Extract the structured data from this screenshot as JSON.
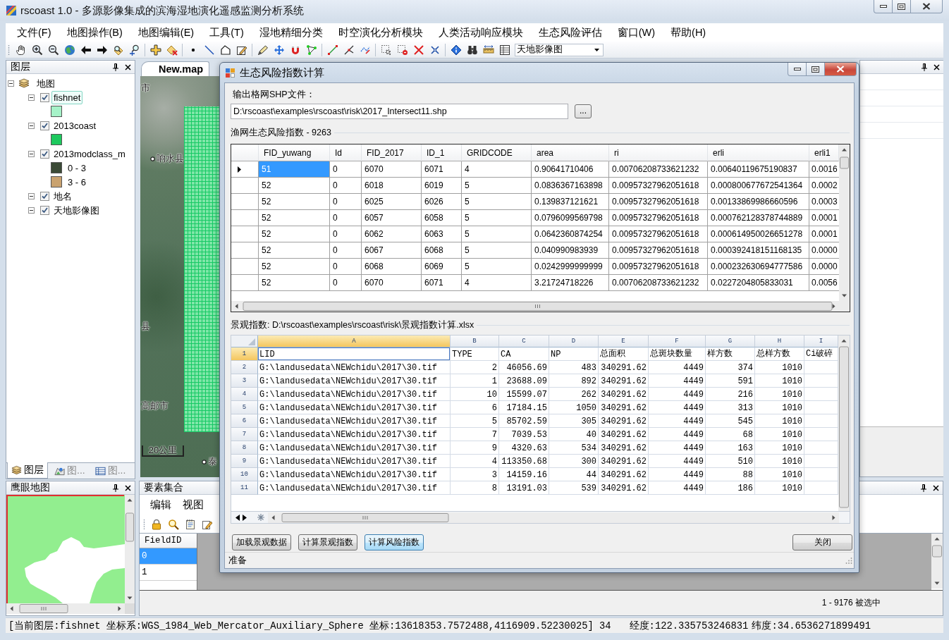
{
  "window": {
    "title": "rscoast 1.0 - 多源影像集成的滨海湿地演化遥感监测分析系统"
  },
  "menu": [
    "文件(F)",
    "地图操作(B)",
    "地图编辑(E)",
    "工具(T)",
    "湿地精细分类",
    "时空演化分析模块",
    "人类活动响应模块",
    "生态风险评估",
    "窗口(W)",
    "帮助(H)"
  ],
  "toolbar": {
    "basemap": "天地影像图"
  },
  "layers_panel": {
    "title": "图层",
    "root": {
      "label": "地图",
      "expanded": true,
      "children": [
        {
          "label": "fishnet",
          "checked": true,
          "expanded": true,
          "selected": true,
          "legend": [
            {
              "color": "#a6f2c8"
            }
          ]
        },
        {
          "label": "2013coast",
          "checked": true,
          "expanded": true,
          "selected": false,
          "legend": [
            {
              "color": "#1ec95e"
            }
          ]
        },
        {
          "label": "2013modclass_m",
          "checked": true,
          "expanded": true,
          "selected": false,
          "legend": [
            {
              "label": "0 - 3",
              "color": "#3b4a36"
            },
            {
              "label": "3 - 6",
              "color": "#c9a26f"
            }
          ]
        },
        {
          "label": "地名",
          "checked": true,
          "expanded": true,
          "selected": false
        },
        {
          "label": "天地影像图",
          "checked": true,
          "expanded": true,
          "selected": false
        }
      ]
    },
    "tabs": [
      {
        "label": "图层",
        "selected": true
      },
      {
        "label": "图...",
        "selected": false
      },
      {
        "label": "图...",
        "selected": false
      }
    ]
  },
  "overview_panel": {
    "title": "鹰眼地图"
  },
  "map_document": {
    "tab": "New.map",
    "place_labels": [
      {
        "text": "市",
        "marker": false
      },
      {
        "text": "响水县",
        "marker": true
      },
      {
        "text": "县",
        "marker": false
      },
      {
        "text": "高邮市",
        "marker": false
      },
      {
        "text": "泰",
        "marker": true
      }
    ],
    "scale_label": "20公里"
  },
  "dialog": {
    "title": "生态风险指数计算",
    "output_label": "输出格网SHP文件：",
    "output_path": "D:\\rscoast\\examples\\rscoast\\risk\\2017_Intersect11.shp",
    "browse_button": "...",
    "grid_label": "渔网生态风险指数 - 9263",
    "grid": {
      "columns": [
        "FID_yuwang",
        "Id",
        "FID_2017",
        "ID_1",
        "GRIDCODE",
        "area",
        "ri",
        "erli",
        "erli1"
      ],
      "rows": [
        {
          "selected": true,
          "cells": [
            "51",
            "0",
            "6070",
            "6071",
            "4",
            "0.90641710406",
            "0.00706208733621232",
            "0.00640119675190837",
            "0.0016"
          ]
        },
        {
          "selected": false,
          "cells": [
            "52",
            "0",
            "6018",
            "6019",
            "5",
            "0.0836367163898",
            "0.00957327962051618",
            "0.000800677672541364",
            "0.0002"
          ]
        },
        {
          "selected": false,
          "cells": [
            "52",
            "0",
            "6025",
            "6026",
            "5",
            "0.139837121621",
            "0.00957327962051618",
            "0.00133869986660596",
            "0.0003"
          ]
        },
        {
          "selected": false,
          "cells": [
            "52",
            "0",
            "6057",
            "6058",
            "5",
            "0.0796099569798",
            "0.00957327962051618",
            "0.000762128378744889",
            "0.0001"
          ]
        },
        {
          "selected": false,
          "cells": [
            "52",
            "0",
            "6062",
            "6063",
            "5",
            "0.0642360874254",
            "0.00957327962051618",
            "0.000614950026651278",
            "0.0001"
          ]
        },
        {
          "selected": false,
          "cells": [
            "52",
            "0",
            "6067",
            "6068",
            "5",
            "0.040990983939",
            "0.00957327962051618",
            "0.000392418151168135",
            "0.0000"
          ]
        },
        {
          "selected": false,
          "cells": [
            "52",
            "0",
            "6068",
            "6069",
            "5",
            "0.0242999999999",
            "0.00957327962051618",
            "0.000232630694777586",
            "0.0000"
          ]
        },
        {
          "selected": false,
          "cells": [
            "52",
            "0",
            "6070",
            "6071",
            "4",
            "3.21724718226",
            "0.00706208733621232",
            "0.0227204805833031",
            "0.0056"
          ]
        }
      ]
    },
    "sheet_label": "景观指数: D:\\rscoast\\examples\\rscoast\\risk\\景观指数计算.xlsx",
    "sheet": {
      "columns": [
        {
          "letter": "A",
          "selected": true
        },
        {
          "letter": "B",
          "selected": false
        },
        {
          "letter": "C",
          "selected": false
        },
        {
          "letter": "D",
          "selected": false
        },
        {
          "letter": "E",
          "selected": false
        },
        {
          "letter": "F",
          "selected": false
        },
        {
          "letter": "G",
          "selected": false
        },
        {
          "letter": "H",
          "selected": false
        },
        {
          "letter": "I",
          "selected": false
        }
      ],
      "rows": [
        {
          "number": "1",
          "selected": true,
          "cells": [
            "LID",
            "TYPE",
            "CA",
            "NP",
            "总面积",
            "总斑块数量",
            "样方数",
            "总样方数",
            "Ci破碎"
          ]
        },
        {
          "number": "2",
          "selected": false,
          "cells": [
            "G:\\landusedata\\NEWchidu\\2017\\30.tif",
            "2",
            "46056.69",
            "483",
            "340291.62",
            "4449",
            "374",
            "1010"
          ]
        },
        {
          "number": "3",
          "selected": false,
          "cells": [
            "G:\\landusedata\\NEWchidu\\2017\\30.tif",
            "1",
            "23688.09",
            "892",
            "340291.62",
            "4449",
            "591",
            "1010"
          ]
        },
        {
          "number": "4",
          "selected": false,
          "cells": [
            "G:\\landusedata\\NEWchidu\\2017\\30.tif",
            "10",
            "15599.07",
            "262",
            "340291.62",
            "4449",
            "216",
            "1010"
          ]
        },
        {
          "number": "5",
          "selected": false,
          "cells": [
            "G:\\landusedata\\NEWchidu\\2017\\30.tif",
            "6",
            "17184.15",
            "1050",
            "340291.62",
            "4449",
            "313",
            "1010"
          ]
        },
        {
          "number": "6",
          "selected": false,
          "cells": [
            "G:\\landusedata\\NEWchidu\\2017\\30.tif",
            "5",
            "85702.59",
            "305",
            "340291.62",
            "4449",
            "545",
            "1010"
          ]
        },
        {
          "number": "7",
          "selected": false,
          "cells": [
            "G:\\landusedata\\NEWchidu\\2017\\30.tif",
            "7",
            "7039.53",
            "40",
            "340291.62",
            "4449",
            "68",
            "1010"
          ]
        },
        {
          "number": "8",
          "selected": false,
          "cells": [
            "G:\\landusedata\\NEWchidu\\2017\\30.tif",
            "9",
            "4320.63",
            "534",
            "340291.62",
            "4449",
            "163",
            "1010"
          ]
        },
        {
          "number": "9",
          "selected": false,
          "cells": [
            "G:\\landusedata\\NEWchidu\\2017\\30.tif",
            "4",
            "113350.68",
            "300",
            "340291.62",
            "4449",
            "510",
            "1010"
          ]
        },
        {
          "number": "10",
          "selected": false,
          "cells": [
            "G:\\landusedata\\NEWchidu\\2017\\30.tif",
            "3",
            "14159.16",
            "44",
            "340291.62",
            "4449",
            "88",
            "1010"
          ]
        },
        {
          "number": "11",
          "selected": false,
          "cells": [
            "G:\\landusedata\\NEWchidu\\2017\\30.tif",
            "8",
            "13191.03",
            "539",
            "340291.62",
            "4449",
            "186",
            "1010"
          ]
        }
      ]
    },
    "buttons": [
      {
        "label": "加载景观数据",
        "focused": false
      },
      {
        "label": "计算景观指数",
        "focused": false
      },
      {
        "label": "计算风险指数",
        "focused": true
      }
    ],
    "close_button": "关闭",
    "status": "准备"
  },
  "feature_panel": {
    "title": "要素集合",
    "menu": [
      "编辑",
      "视图"
    ],
    "table": {
      "column": "FieldID",
      "rows": [
        {
          "value": "0",
          "selected": true
        },
        {
          "value": "1",
          "selected": false
        }
      ]
    },
    "selection_count": "1 - 9176 被选中"
  },
  "status_bar": {
    "layer_info": "[当前图层:fishnet 坐标系:WGS_1984_Web_Mercator_Auxiliary_Sphere 坐标:13618353.7572488,4116909.52230025] 34",
    "longitude": "经度:122.335753246831",
    "latitude": "纬度:34.6536271899491"
  }
}
